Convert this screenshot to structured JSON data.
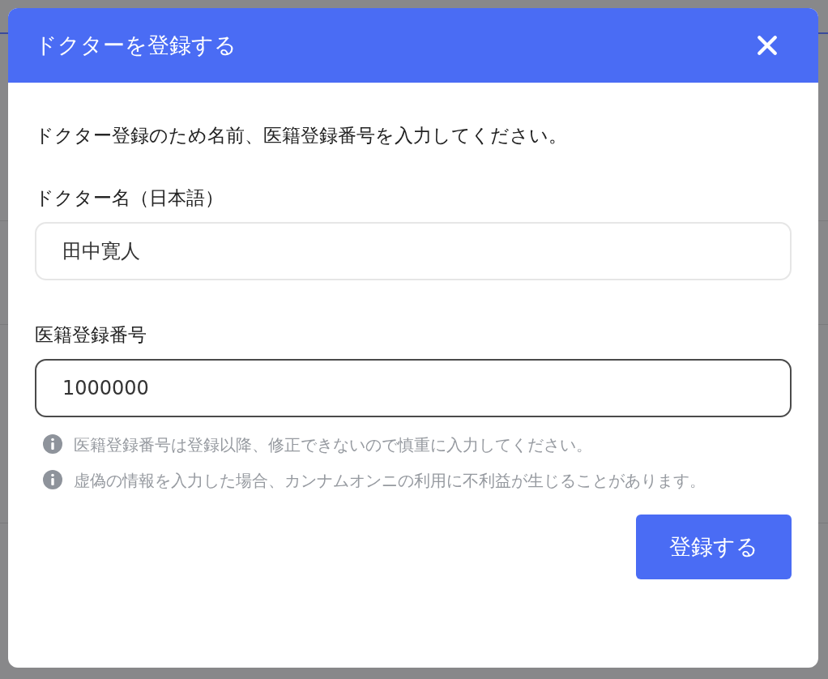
{
  "dialog": {
    "title": "ドクターを登録する",
    "description": "ドクター登録のため名前、医籍登録番号を入力してください。",
    "fields": [
      {
        "label": "ドクター名（日本語）",
        "value": "田中寛人",
        "focused": false
      },
      {
        "label": "医籍登録番号",
        "value": "1000000",
        "focused": true
      }
    ],
    "notes": [
      "医籍登録番号は登録以降、修正できないので慎重に入力してください。",
      "虚偽の情報を入力した場合、カンナムオンニの利用に不利益が生じることがあります。"
    ],
    "submit_button": "登録する"
  }
}
